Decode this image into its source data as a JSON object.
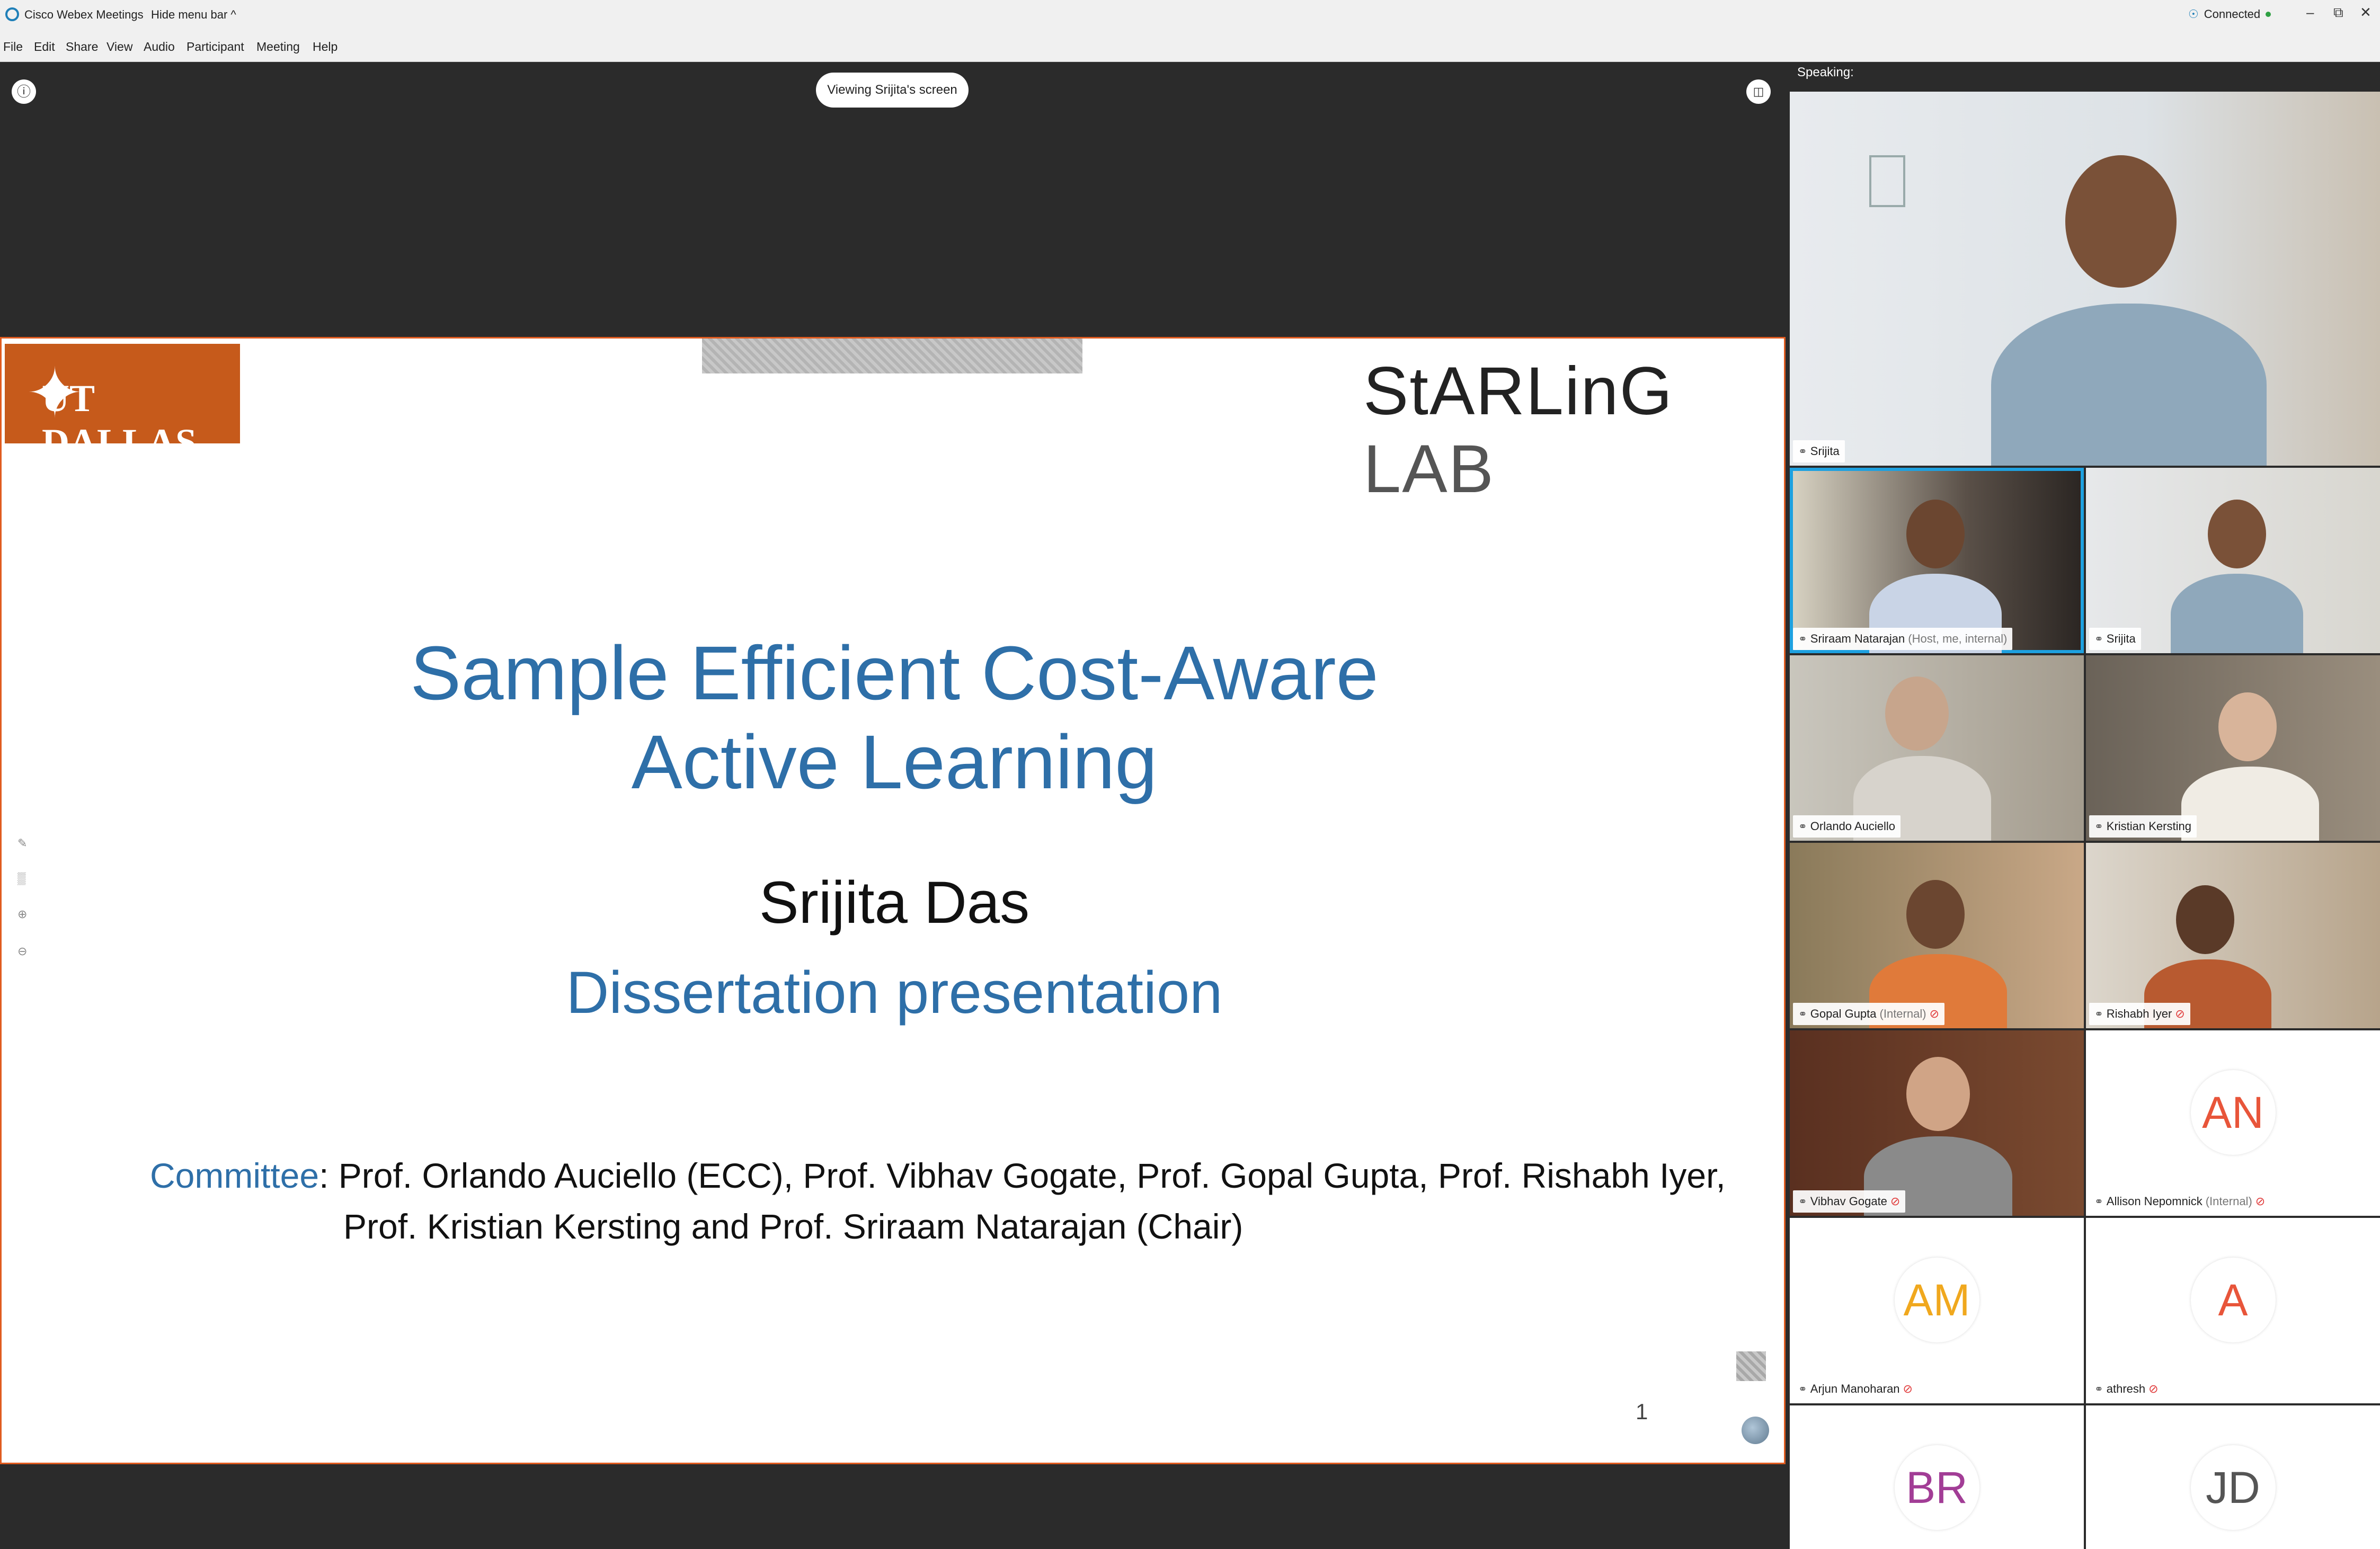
{
  "app": {
    "title": "Cisco Webex Meetings",
    "hide_menu_bar": "Hide menu bar ^",
    "status": "Connected"
  },
  "menu": [
    "File",
    "Edit",
    "Share",
    "View",
    "Audio",
    "Participant",
    "Meeting",
    "Help"
  ],
  "share": {
    "viewing_label": "Viewing Srijita's screen"
  },
  "slide": {
    "utd_logo_text": "UT DALLAS",
    "lab_logo_text_1": "StARLinG",
    "lab_logo_text_2": "LAB",
    "title_line1": "Sample Efficient Cost-Aware",
    "title_line2": "Active Learning",
    "author": "Srijita Das",
    "subtitle": "Dissertation presentation",
    "committee_label": "Committee",
    "committee_line1": ":  Prof. Orlando Auciello (ECC), Prof. Vibhav Gogate, Prof. Gopal Gupta, Prof. Rishabh Iyer,",
    "committee_line2": "Prof. Kristian Kersting and Prof. Sriraam Natarajan (Chair)",
    "page_number": "1"
  },
  "panel": {
    "speaking_label": "Speaking:",
    "featured": {
      "name": "Srijita"
    },
    "participants": [
      {
        "name": "Sriraam Natarajan",
        "sub": "(Host, me, internal)",
        "muted": false,
        "active": true
      },
      {
        "name": "Srijita",
        "sub": "",
        "muted": false,
        "active": false
      },
      {
        "name": "Orlando Auciello",
        "sub": "",
        "muted": false,
        "active": false
      },
      {
        "name": "Kristian Kersting",
        "sub": "",
        "muted": false,
        "active": false
      },
      {
        "name": "Gopal Gupta",
        "sub": "(Internal)",
        "muted": true,
        "active": false
      },
      {
        "name": "Rishabh Iyer",
        "sub": "",
        "muted": true,
        "active": false
      },
      {
        "name": "Vibhav Gogate",
        "sub": "",
        "muted": true,
        "active": false
      },
      {
        "name": "Allison Nepomnick",
        "sub": "(Internal)",
        "muted": true,
        "initials": "AN",
        "color": "#e8553a"
      },
      {
        "name": "Arjun Manoharan",
        "sub": "",
        "muted": true,
        "initials": "AM",
        "color": "#f0a81e"
      },
      {
        "name": "athresh",
        "sub": "",
        "muted": true,
        "initials": "A",
        "color": "#e8553a"
      },
      {
        "name": "",
        "sub": "",
        "muted": false,
        "initials": "BR",
        "color": "#a23d96"
      },
      {
        "name": "",
        "sub": "",
        "muted": false,
        "initials": "JD",
        "color": "#555555"
      }
    ]
  }
}
